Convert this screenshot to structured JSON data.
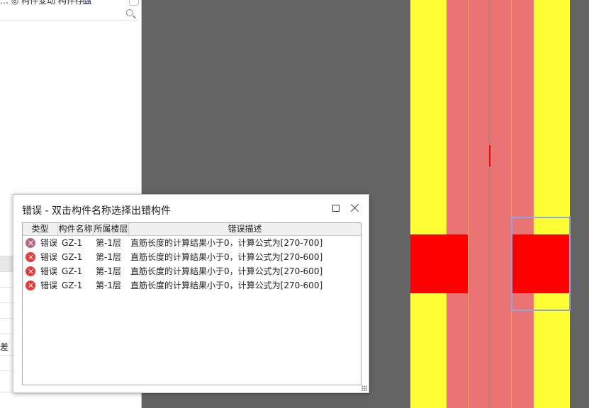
{
  "left_panel": {
    "toolbar_text": "… ◎ 构件变动   构件存盘",
    "row_labels": [
      "",
      "",
      "",
      "",
      "",
      "",
      "差",
      "",
      ""
    ]
  },
  "dialog": {
    "title": "错误 - 双击构件名称选择出错构件",
    "columns": [
      "类型",
      "构件名称",
      "所属楼层",
      "错误描述"
    ],
    "rows": [
      {
        "type": "错误",
        "name": "GZ-1",
        "floor": "第-1层",
        "desc": "直筋长度的计算结果小于0，计算公式为[270-700]",
        "icon": "error-icon-muted"
      },
      {
        "type": "错误",
        "name": "GZ-1",
        "floor": "第-1层",
        "desc": "直筋长度的计算结果小于0，计算公式为[270-600]",
        "icon": "error-icon"
      },
      {
        "type": "错误",
        "name": "GZ-1",
        "floor": "第-1层",
        "desc": "直筋长度的计算结果小于0，计算公式为[270-600]",
        "icon": "error-icon"
      },
      {
        "type": "错误",
        "name": "GZ-1",
        "floor": "第-1层",
        "desc": "直筋长度的计算结果小于0，计算公式为[270-600]",
        "icon": "error-icon"
      }
    ]
  },
  "colors": {
    "canvas_bg": "#646464",
    "yellow_band": "#ffff33",
    "salmon_band": "#ea7373",
    "red_block": "#ff0000",
    "selection": "#8ea6de",
    "error_icon": "#e23b3b"
  }
}
